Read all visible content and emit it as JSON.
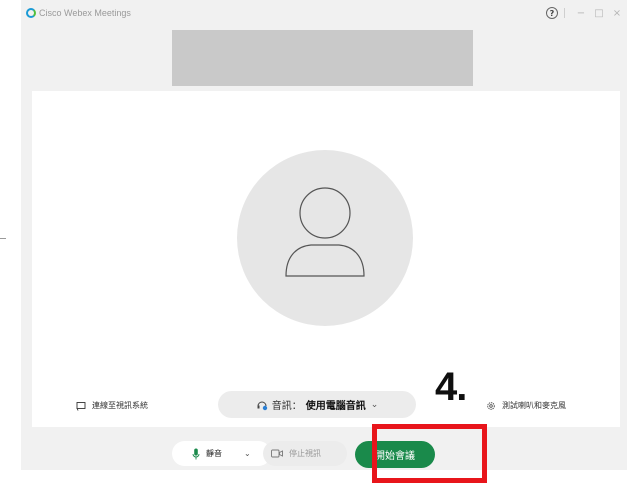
{
  "titlebar": {
    "app_title": "Cisco Webex Meetings",
    "help_glyph": "?",
    "minimize_glyph": "−",
    "maximize_glyph": "□",
    "close_glyph": "×"
  },
  "preview": {
    "connect_video_label": "連線至視訊系統",
    "audio_label": "音訊：",
    "audio_value": "使用電腦音訊",
    "audio_chevron": "⌄",
    "test_speaker_label": "測試喇叭和麥克風"
  },
  "annotation": {
    "step_number": "4."
  },
  "controls": {
    "mute_label": "靜音",
    "mute_chevron": "⌄",
    "stop_video_label": "停止視訊",
    "start_meeting_label": "開始會議"
  },
  "colors": {
    "accent_green": "#1a8a4b",
    "highlight_red": "#e8151b",
    "window_bg": "#f1f1f1",
    "banner_gray": "#c9c9c9"
  },
  "icons": {
    "app_logo": "webex-logo-icon",
    "help": "help-icon",
    "connect_video": "cast-icon",
    "audio": "headset-icon",
    "settings": "gear-icon",
    "mute": "microphone-icon",
    "video": "video-camera-icon",
    "avatar": "user-placeholder-icon"
  }
}
